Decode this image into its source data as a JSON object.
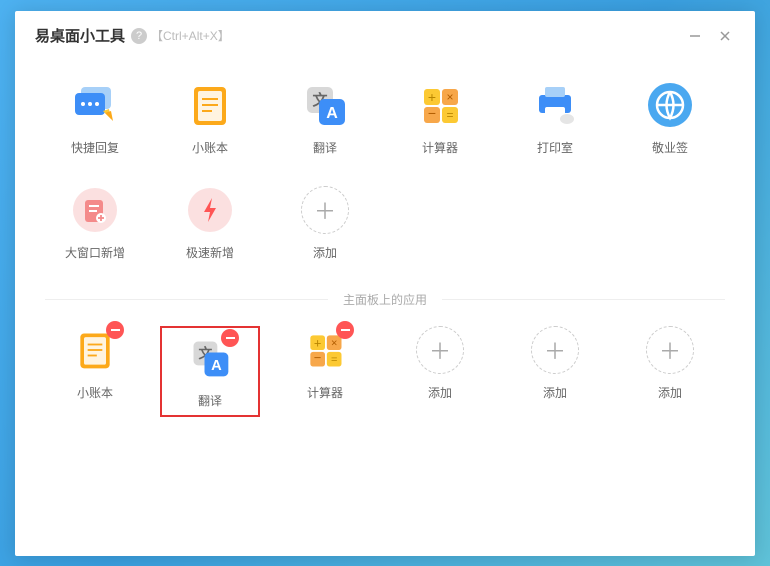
{
  "titlebar": {
    "title": "易桌面小工具",
    "shortcut": "【Ctrl+Alt+X】"
  },
  "tools": {
    "quick_reply": "快捷回复",
    "notebook": "小账本",
    "translate": "翻译",
    "calculator": "计算器",
    "print": "打印室",
    "sign": "敬业签",
    "big_window_add": "大窗口新增",
    "quick_add": "极速新增",
    "add": "添加"
  },
  "divider_label": "主面板上的应用",
  "panel": {
    "notebook": "小账本",
    "translate": "翻译",
    "calculator": "计算器",
    "add1": "添加",
    "add2": "添加",
    "add3": "添加"
  }
}
